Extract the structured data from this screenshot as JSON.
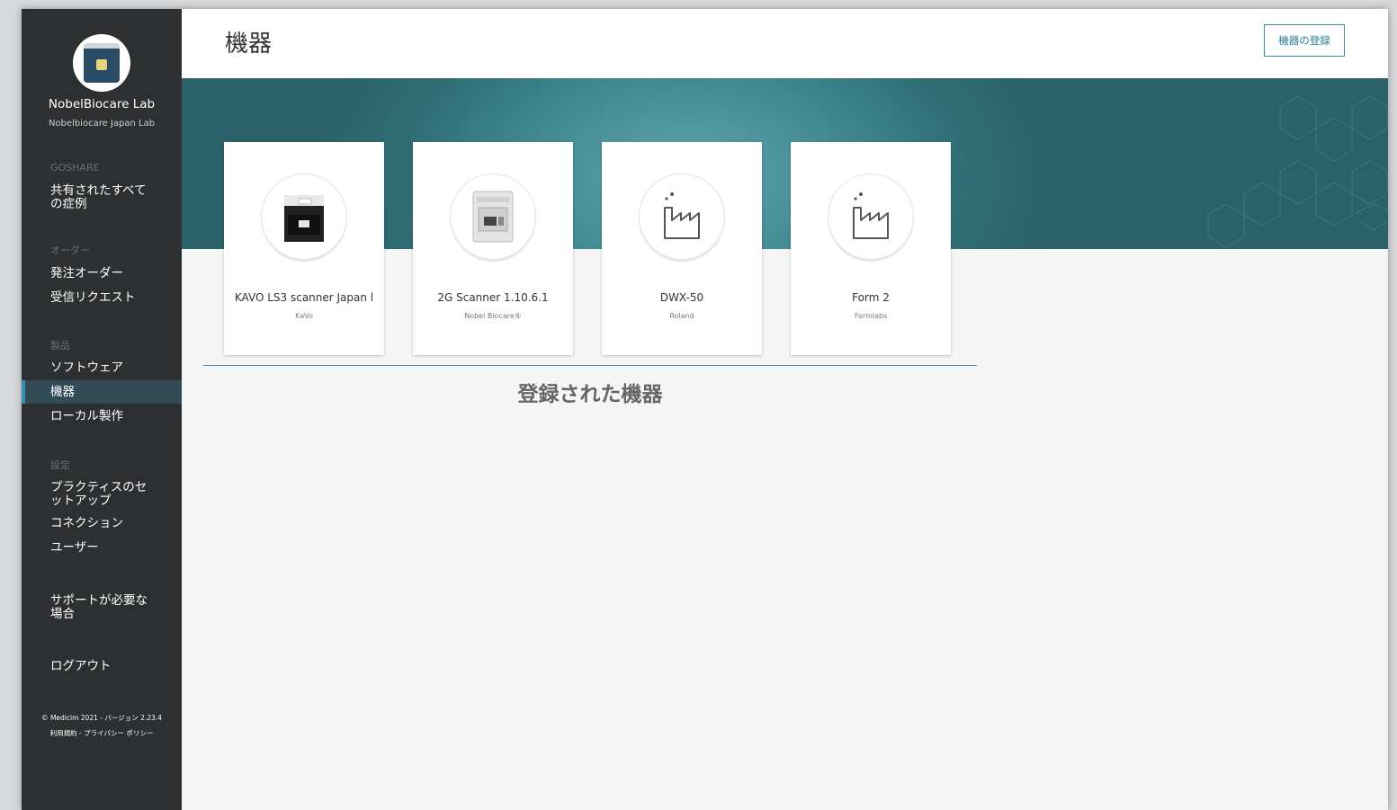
{
  "sidebar": {
    "lab_name": "NobelBiocare Lab",
    "lab_subname": "Nobelbiocare Japan Lab",
    "sections": {
      "goshare": "GOSHARE",
      "orders": "オーダー",
      "products": "製品",
      "settings": "設定"
    },
    "items": {
      "shared_cases": "共有されたすべての症例",
      "outgoing_orders": "発注オーダー",
      "incoming_requests": "受信リクエスト",
      "software": "ソフトウェア",
      "devices": "機器",
      "local_production": "ローカル製作",
      "practice_setup": "プラクティスのセットアップ",
      "connections": "コネクション",
      "users": "ユーザー",
      "support": "サポートが必要な場合",
      "logout": "ログアウト"
    },
    "footer": {
      "copyright": "© Medicim 2021 - バージョン 2.23.4",
      "terms": "利用規約",
      "separator": " - ",
      "privacy": "プライバシー ポリシー"
    }
  },
  "header": {
    "title": "機器",
    "register_button": "機器の登録"
  },
  "devices": [
    {
      "name": "KAVO LS3 scanner Japan l",
      "maker": "KaVo",
      "icon": "scanner-device-icon"
    },
    {
      "name": "2G Scanner 1.10.6.1",
      "maker": "Nobel Biocare®",
      "icon": "scanner-device-icon"
    },
    {
      "name": "DWX-50",
      "maker": "Roland",
      "icon": "factory-icon"
    },
    {
      "name": "Form 2",
      "maker": "Formlabs",
      "icon": "factory-icon"
    }
  ],
  "section_label": "登録された機器",
  "colors": {
    "sidebar_bg": "#2d2f31",
    "active_item_bg": "#324c57",
    "accent": "#3a8fb3",
    "banner_teal": "#3f8890"
  }
}
